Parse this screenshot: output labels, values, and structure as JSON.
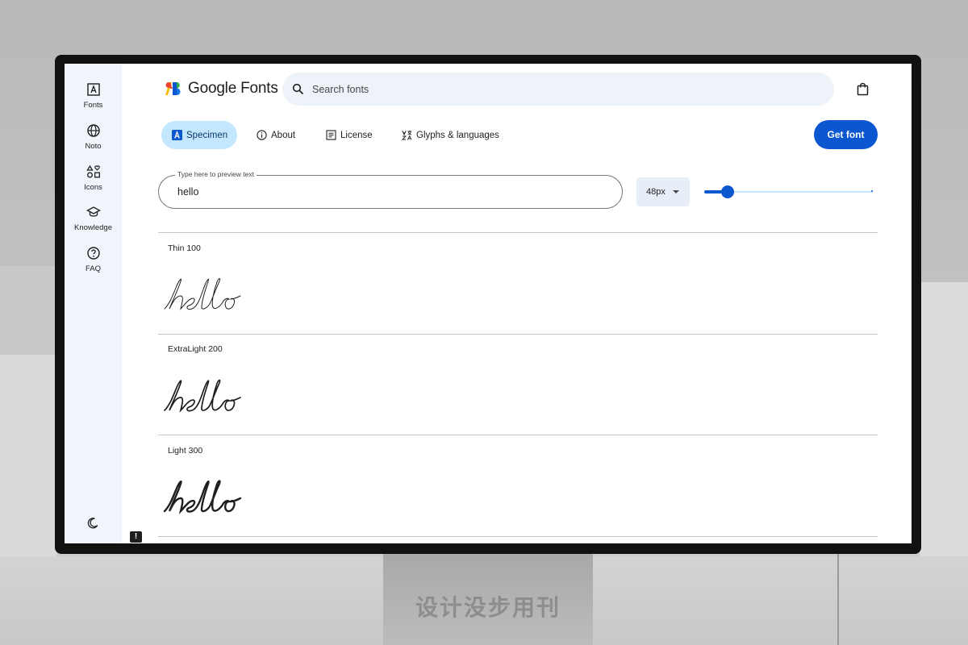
{
  "sidebar": {
    "items": [
      {
        "label": "Fonts",
        "icon": "font-icon"
      },
      {
        "label": "Noto",
        "icon": "globe-icon"
      },
      {
        "label": "Icons",
        "icon": "shapes-icon"
      },
      {
        "label": "Knowledge",
        "icon": "school-icon"
      },
      {
        "label": "FAQ",
        "icon": "help-icon"
      }
    ],
    "theme_toggle_icon": "moon-icon"
  },
  "header": {
    "logo_text": "Google Fonts",
    "search_placeholder": "Search fonts",
    "bag_icon": "shopping-bag-icon"
  },
  "tabs": [
    {
      "label": "Specimen",
      "active": true,
      "icon": "specimen-icon"
    },
    {
      "label": "About",
      "active": false,
      "icon": "info-icon"
    },
    {
      "label": "License",
      "active": false,
      "icon": "article-icon"
    },
    {
      "label": "Glyphs & languages",
      "active": false,
      "icon": "translate-icon"
    }
  ],
  "get_font_label": "Get font",
  "preview": {
    "legend": "Type here to preview text",
    "value": "hello",
    "size_label": "48px",
    "size_slider_fraction": 0.14
  },
  "weights": [
    {
      "label": "Thin 100",
      "sample": "hello"
    },
    {
      "label": "ExtraLight 200",
      "sample": "hello"
    },
    {
      "label": "Light 300",
      "sample": "hello"
    }
  ],
  "colors": {
    "accent": "#0b57d0",
    "active_tab": "#c2e7ff",
    "sidebar_bg": "#f0f4fb"
  },
  "background": {
    "stand_text": "设计没步用刊"
  }
}
